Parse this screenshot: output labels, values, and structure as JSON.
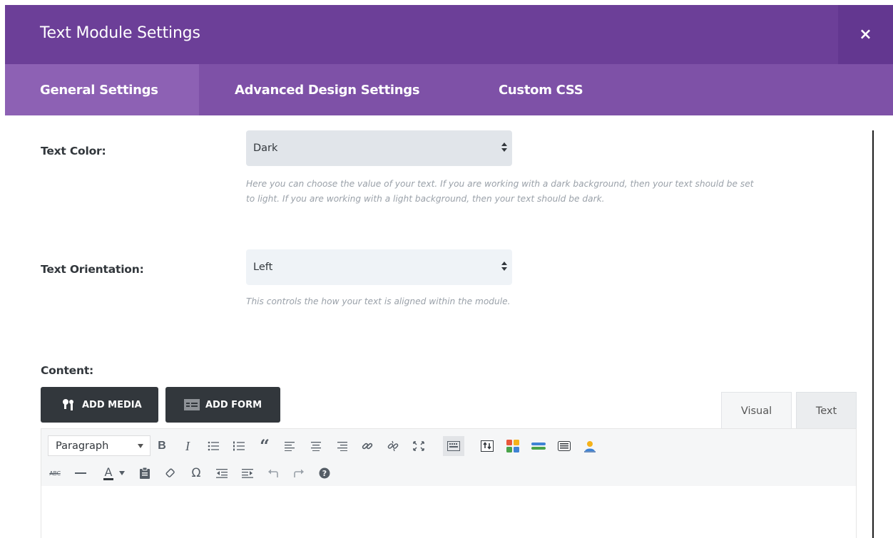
{
  "modal": {
    "title": "Text Module Settings",
    "close_glyph": "×"
  },
  "tabs": [
    {
      "label": "General Settings",
      "active": true
    },
    {
      "label": "Advanced Design Settings",
      "active": false
    },
    {
      "label": "Custom CSS",
      "active": false
    }
  ],
  "fields": {
    "text_color": {
      "label": "Text Color:",
      "value": "Dark",
      "description": "Here you can choose the value of your text. If you are working with a dark background, then your text should be set to light. If you are working with a light background, then your text should be dark."
    },
    "text_orientation": {
      "label": "Text Orientation:",
      "value": "Left",
      "description": "This controls the how your text is aligned within the module."
    },
    "content": {
      "label": "Content:"
    }
  },
  "editor": {
    "add_media_label": "ADD MEDIA",
    "add_form_label": "ADD FORM",
    "tabs": {
      "visual": "Visual",
      "text": "Text"
    },
    "format_select_value": "Paragraph",
    "glyphs": {
      "bold": "B",
      "italic": "I",
      "blockquote": "“",
      "strikethrough": "ABC",
      "text_color": "A",
      "special_char": "Ω"
    },
    "toolbar_row1_icons": [
      "bold-icon",
      "italic-icon",
      "bullet-list-icon",
      "numbered-list-icon",
      "blockquote-icon",
      "align-left-icon",
      "align-center-icon",
      "align-right-icon",
      "link-icon",
      "unlink-icon",
      "fullscreen-icon",
      "toolbar-toggle-icon",
      "upload-icon",
      "colored-grid-icon",
      "colored-bars-icon",
      "document-icon",
      "user-icon"
    ],
    "toolbar_row2_icons": [
      "strikethrough-icon",
      "horizontal-rule-icon",
      "text-color-icon",
      "paste-text-icon",
      "clear-formatting-icon",
      "special-character-icon",
      "outdent-icon",
      "indent-icon",
      "undo-icon",
      "redo-icon",
      "help-icon"
    ]
  },
  "colors": {
    "header": "#6c3f98",
    "close_bg": "#633790",
    "tabbar": "#7e51a7",
    "active_tab": "#8d61b4",
    "dark_button": "#32373c",
    "select_dark_bg": "#e1e5ea",
    "select_light_bg": "#eff3f7"
  }
}
